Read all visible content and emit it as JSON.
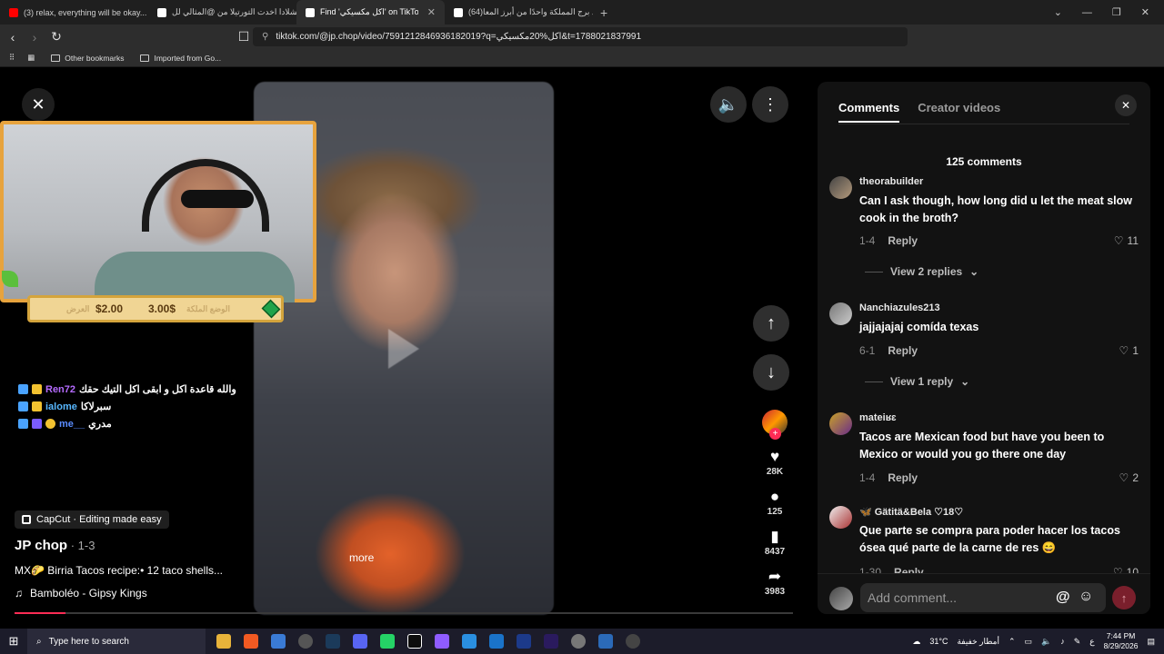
{
  "browser": {
    "tabs": [
      {
        "title": "(3) relax, everything will be okay... (m",
        "color": "#ff0000",
        "active": false
      },
      {
        "title": "انشلادا اخدت التورتيلا من @المثالي لل...",
        "color": "#ffffff",
        "active": false
      },
      {
        "title": "Find 'اكل مكسيكي' on TikTok | Tik",
        "color": "#ffffff",
        "active": true
      },
      {
        "title": "(64)يعد برج المملكة واحدًا من أبرز المعا",
        "color": "#ffffff",
        "active": false
      }
    ],
    "new_tab": "+",
    "url": "tiktok.com/@jp.chop/video/7591212846936182019?q=اكل%20مكسيكي&t=1788021837991",
    "bookmarks": [
      "Other bookmarks",
      "Imported from Go..."
    ]
  },
  "stream": {
    "donations": {
      "left_amount": "$2.00",
      "right_amount": "3.00$",
      "sub_left": "العرض",
      "sub_right": "الوضع الملكة"
    },
    "chat": [
      {
        "name": "Ren72",
        "message": "والله قاعدة اكل و ابقى اكل التيك حقك"
      },
      {
        "name": "ialome",
        "message": "سبرلاكا"
      },
      {
        "name": "me__",
        "message": "مدري"
      }
    ]
  },
  "video": {
    "capcut": "CapCut · Editing made easy",
    "author": "JP chop",
    "date": " · 1-3",
    "description": "MX🌮 Birria Tacos recipe:• 12 taco shells...",
    "more": "more",
    "music": "Bamboléo - Gipsy Kings",
    "progress": 0.065
  },
  "actions": {
    "likes": "28K",
    "comments": "125",
    "saves": "8437",
    "shares": "3983"
  },
  "comments_panel": {
    "tab_comments": "Comments",
    "tab_creator": "Creator videos",
    "count": "125 comments",
    "items": [
      {
        "user": "theorabuilder",
        "text": "Can I ask though, how long did u let the meat slow cook in the broth?",
        "date": "1-4",
        "reply": "Reply",
        "likes": "11",
        "view": "View 2 replies"
      },
      {
        "user": "Nanchiazules213",
        "text": "jajjajajaj comída texas",
        "date": "6-1",
        "reply": "Reply",
        "likes": "1",
        "view": "View 1 reply"
      },
      {
        "user": "mateiʁɛ",
        "text": "Tacos are Mexican food but have you been to Mexico or would you go there one day",
        "date": "1-4",
        "reply": "Reply",
        "likes": "2"
      },
      {
        "user": "🦋 Gätitä&Bela ♡18♡",
        "text": "Que parte se compra para poder hacer los tacos ósea qué parte de la carne de res 😄",
        "date": "1-30",
        "reply": "Reply",
        "likes": "10"
      }
    ],
    "placeholder": "Add comment..."
  },
  "taskbar": {
    "search": "Type here to search",
    "weather": "31°C",
    "weather_text": "أمطار خفيفة",
    "lang": "ع",
    "time": "7:44 PM",
    "date": "8/29/2026"
  }
}
